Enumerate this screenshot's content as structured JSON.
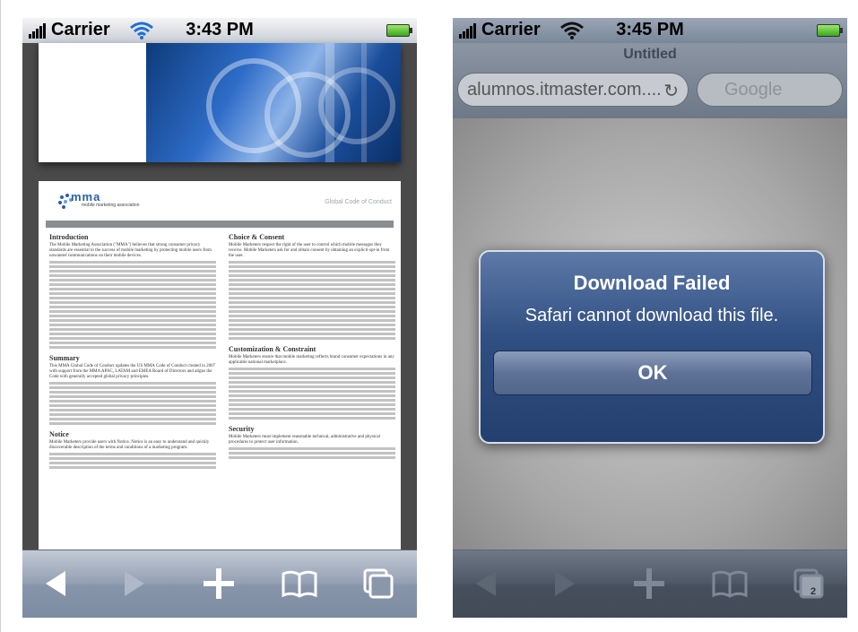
{
  "left_phone": {
    "status": {
      "carrier": "Carrier",
      "time": "3:43 PM"
    },
    "document": {
      "logo_text": "mma",
      "logo_subtitle": "mobile marketing association",
      "header_right": "Global Code of Conduct",
      "left_column": [
        {
          "heading": "Introduction",
          "text": "The Mobile Marketing Association (\"MMA\") believes that strong consumer privacy standards are essential to the success of mobile marketing by protecting mobile users from unwanted communications on their mobile devices."
        },
        {
          "heading": "Summary",
          "text": "This MMA Global Code of Conduct updates the US MMA Code of Conduct created in 2007 with support from the MMA APAC, LATAM and EMEA Board of Directors and aligns the Code with generally accepted global privacy principles."
        },
        {
          "heading": "Notice",
          "text": "Mobile Marketers provide users with Notice. Notice is an easy to understand and quickly discoverable description of the terms and conditions of a marketing program."
        }
      ],
      "right_column": [
        {
          "heading": "Choice & Consent",
          "text": "Mobile Marketers respect the right of the user to control which mobile messages they receive. Mobile Marketers ask for and obtain consent by obtaining an explicit opt-in from the user."
        },
        {
          "heading": "Customization & Constraint",
          "text": "Mobile Marketers ensure that mobile marketing reflects brand consumer expectations in any applicable national marketplace."
        },
        {
          "heading": "Security",
          "text": "Mobile Marketers must implement reasonable technical, administrative and physical procedures to protect user information."
        }
      ]
    },
    "toolbar": {
      "back_icon": "back-arrow-icon",
      "forward_icon": "forward-arrow-icon",
      "add_icon": "plus-icon",
      "bookmarks_icon": "book-icon",
      "pages_icon": "pages-icon"
    }
  },
  "right_phone": {
    "status": {
      "carrier": "Carrier",
      "time": "3:45 PM"
    },
    "nav": {
      "title": "Untitled",
      "url": "alumnos.itmaster.com....",
      "search_placeholder": "Google"
    },
    "alert": {
      "title": "Download Failed",
      "message": "Safari cannot download this file.",
      "ok_label": "OK"
    },
    "toolbar": {
      "pages_count": "2"
    }
  }
}
